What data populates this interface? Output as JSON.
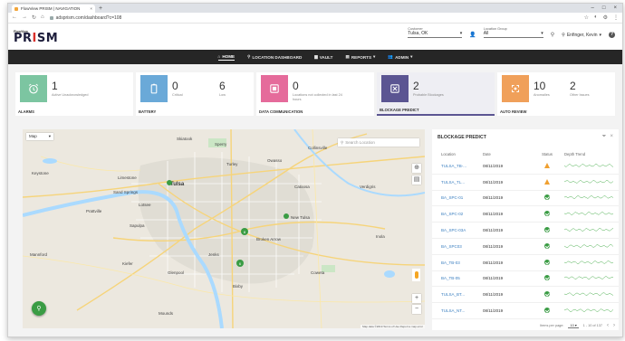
{
  "browser": {
    "tab_title": "FlowView PRISM | NAVIGATION",
    "url": "adsprism.com/dashboard?c=108"
  },
  "header": {
    "logo_small": "FlowView",
    "logo_main": "PRISM",
    "customer_label": "Customer",
    "customer_value": "Tulsa, OK",
    "location_group_label": "Location Group",
    "location_group_value": "All",
    "user_name": "Enfinger, Kevin"
  },
  "nav": {
    "items": [
      {
        "label": "HOME",
        "active": true
      },
      {
        "label": "LOCATION DASHBOARD"
      },
      {
        "label": "VAULT"
      },
      {
        "label": "REPORTS"
      },
      {
        "label": "ADMIN"
      }
    ]
  },
  "cards": [
    {
      "caption": "ALARMS",
      "color": "#7cc5a1",
      "icon": "alarm-clock-icon",
      "v1": "1",
      "l1": "Active Unacknowledged"
    },
    {
      "caption": "BATTERY",
      "color": "#6aa9d8",
      "icon": "battery-icon",
      "v1": "0",
      "l1": "Critical",
      "v2": "6",
      "l2": "Low"
    },
    {
      "caption": "DATA COMMUNICATION",
      "color": "#e56b9b",
      "icon": "data-comm-icon",
      "v1": "0",
      "l1": "Locations not collected in last 24 hours"
    },
    {
      "caption": "BLOCKAGE PREDICT",
      "color": "#5b5592",
      "icon": "blockage-icon",
      "v1": "2",
      "l1": "Probable Blockages"
    },
    {
      "caption": "AUTO REVIEW",
      "color": "#f0a05a",
      "icon": "auto-review-icon",
      "v1": "10",
      "l1": "Anomalies",
      "v2": "2",
      "l2": "Other Issues"
    }
  ],
  "map": {
    "type_label": "Map",
    "search_placeholder": "Search Location",
    "cities": [
      {
        "name": "Tulsa",
        "big": true
      },
      {
        "name": "Broken Arrow"
      },
      {
        "name": "Sand Springs"
      },
      {
        "name": "Sapulpa"
      },
      {
        "name": "Jenks"
      },
      {
        "name": "Bixby"
      },
      {
        "name": "Owasso"
      },
      {
        "name": "Catoosa"
      },
      {
        "name": "Coweta"
      },
      {
        "name": "Skiatook"
      },
      {
        "name": "Sperry"
      },
      {
        "name": "Collinsville"
      },
      {
        "name": "Prattville"
      },
      {
        "name": "Glenpool"
      },
      {
        "name": "Kiefer"
      },
      {
        "name": "Mounds"
      },
      {
        "name": "New Tulsa"
      },
      {
        "name": "Turley"
      },
      {
        "name": "Limestone"
      },
      {
        "name": "Lotsee"
      },
      {
        "name": "Keystone"
      },
      {
        "name": "Mannford"
      },
      {
        "name": "Verdigris"
      },
      {
        "name": "Inola"
      }
    ],
    "cluster_labels": [
      "8",
      "6"
    ],
    "attribution": "Map data ©2019   Terms of Use   Report a map error"
  },
  "panel": {
    "title": "BLOCKAGE PREDICT",
    "headers": [
      "Location",
      "Date",
      "Status",
      "Depth Trend"
    ],
    "rows": [
      {
        "location": "TULSA_TB-...",
        "date": "08/11/2019",
        "status": "warn"
      },
      {
        "location": "TULSA_TL...",
        "date": "08/11/2019",
        "status": "warn"
      },
      {
        "location": "BA_SPC-01",
        "date": "08/11/2019",
        "status": "ok"
      },
      {
        "location": "BA_SPC-02",
        "date": "08/11/2019",
        "status": "ok"
      },
      {
        "location": "BA_SPC-03A",
        "date": "08/11/2019",
        "status": "ok"
      },
      {
        "location": "BA_SPC03",
        "date": "08/11/2019",
        "status": "ok"
      },
      {
        "location": "BA_TB-03",
        "date": "08/11/2019",
        "status": "ok"
      },
      {
        "location": "BA_TB-05",
        "date": "08/11/2019",
        "status": "ok"
      },
      {
        "location": "TULSA_BT...",
        "date": "08/11/2019",
        "status": "ok"
      },
      {
        "location": "TULSA_NT...",
        "date": "08/11/2019",
        "status": "ok"
      }
    ],
    "items_per_page_label": "Items per page:",
    "items_per_page": "10",
    "range": "1 - 10 of 137"
  }
}
